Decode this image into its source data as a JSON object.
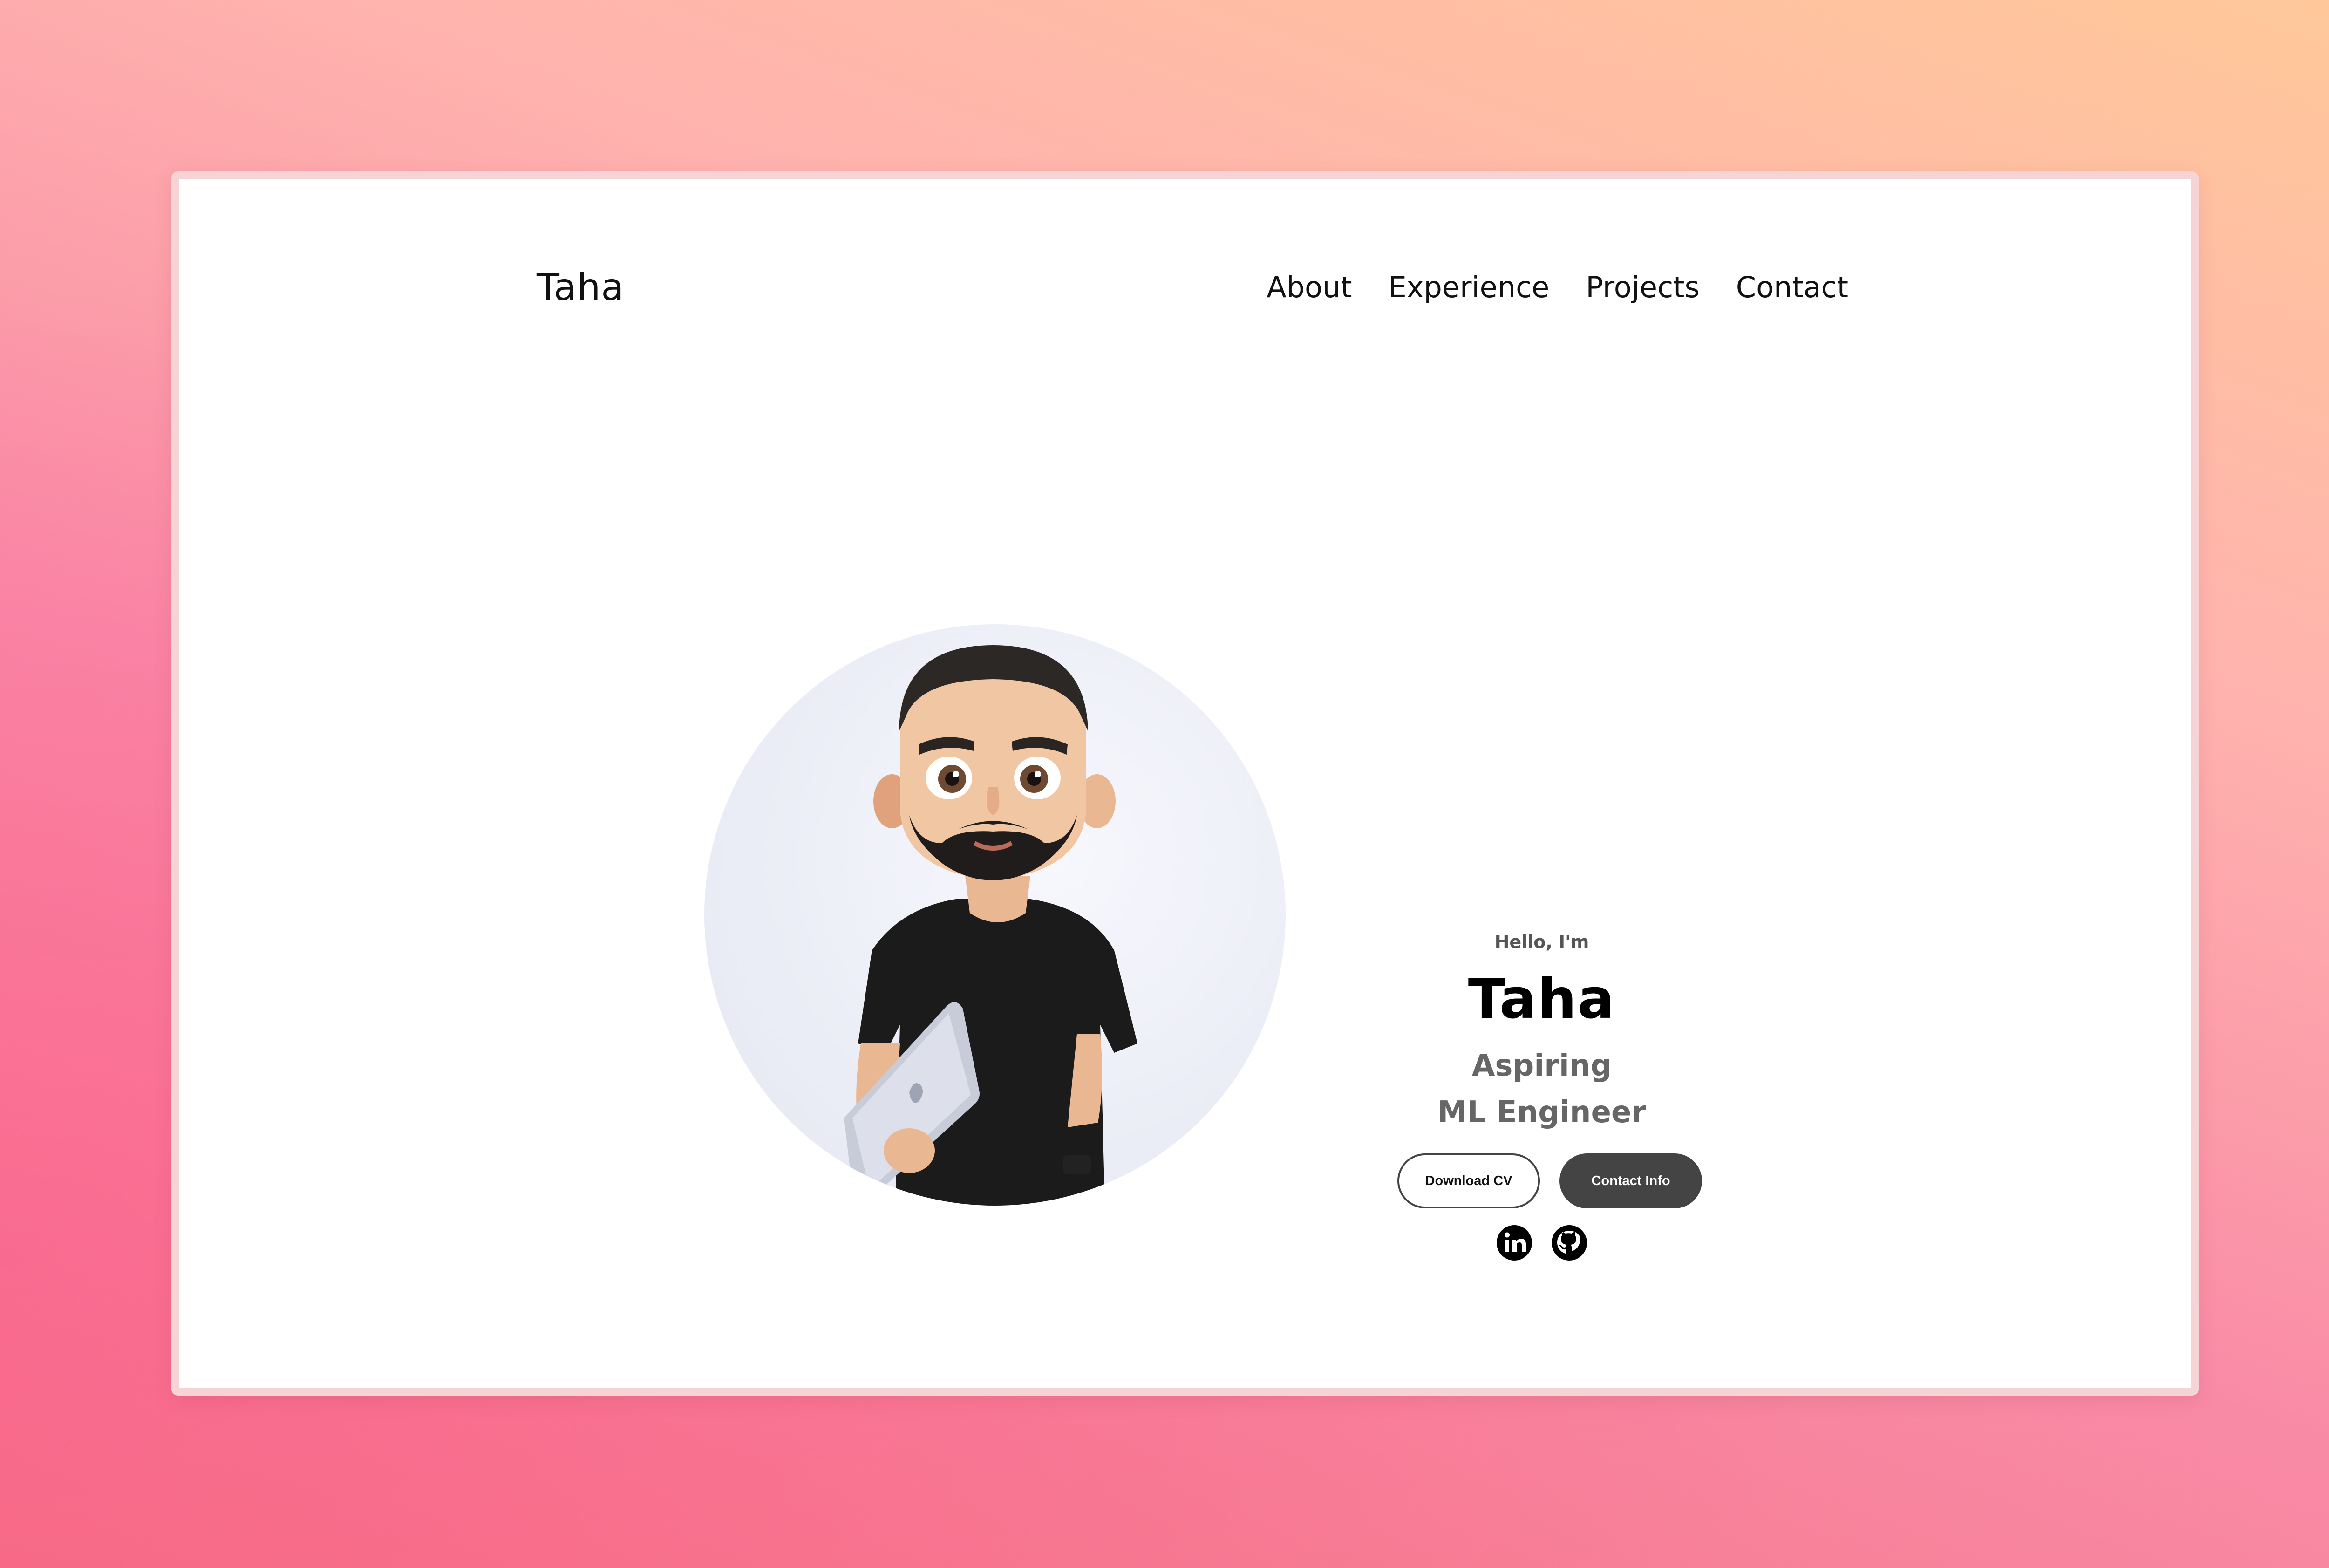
{
  "nav": {
    "brand": "Taha",
    "links": [
      "About",
      "Experience",
      "Projects",
      "Contact"
    ]
  },
  "hero": {
    "greeting": "Hello, I'm",
    "name": "Taha",
    "role_line1": "Aspiring",
    "role_line2": "ML Engineer",
    "download_cv_label": "Download CV",
    "contact_info_label": "Contact Info"
  },
  "social": {
    "linkedin_icon": "linkedin-icon",
    "github_icon": "github-icon"
  },
  "colors": {
    "background_top": "#ffc89a",
    "background_bottom": "#f4707f",
    "card_border": "#f6d4d6",
    "primary_button": "#444444",
    "role_text": "#666666"
  }
}
